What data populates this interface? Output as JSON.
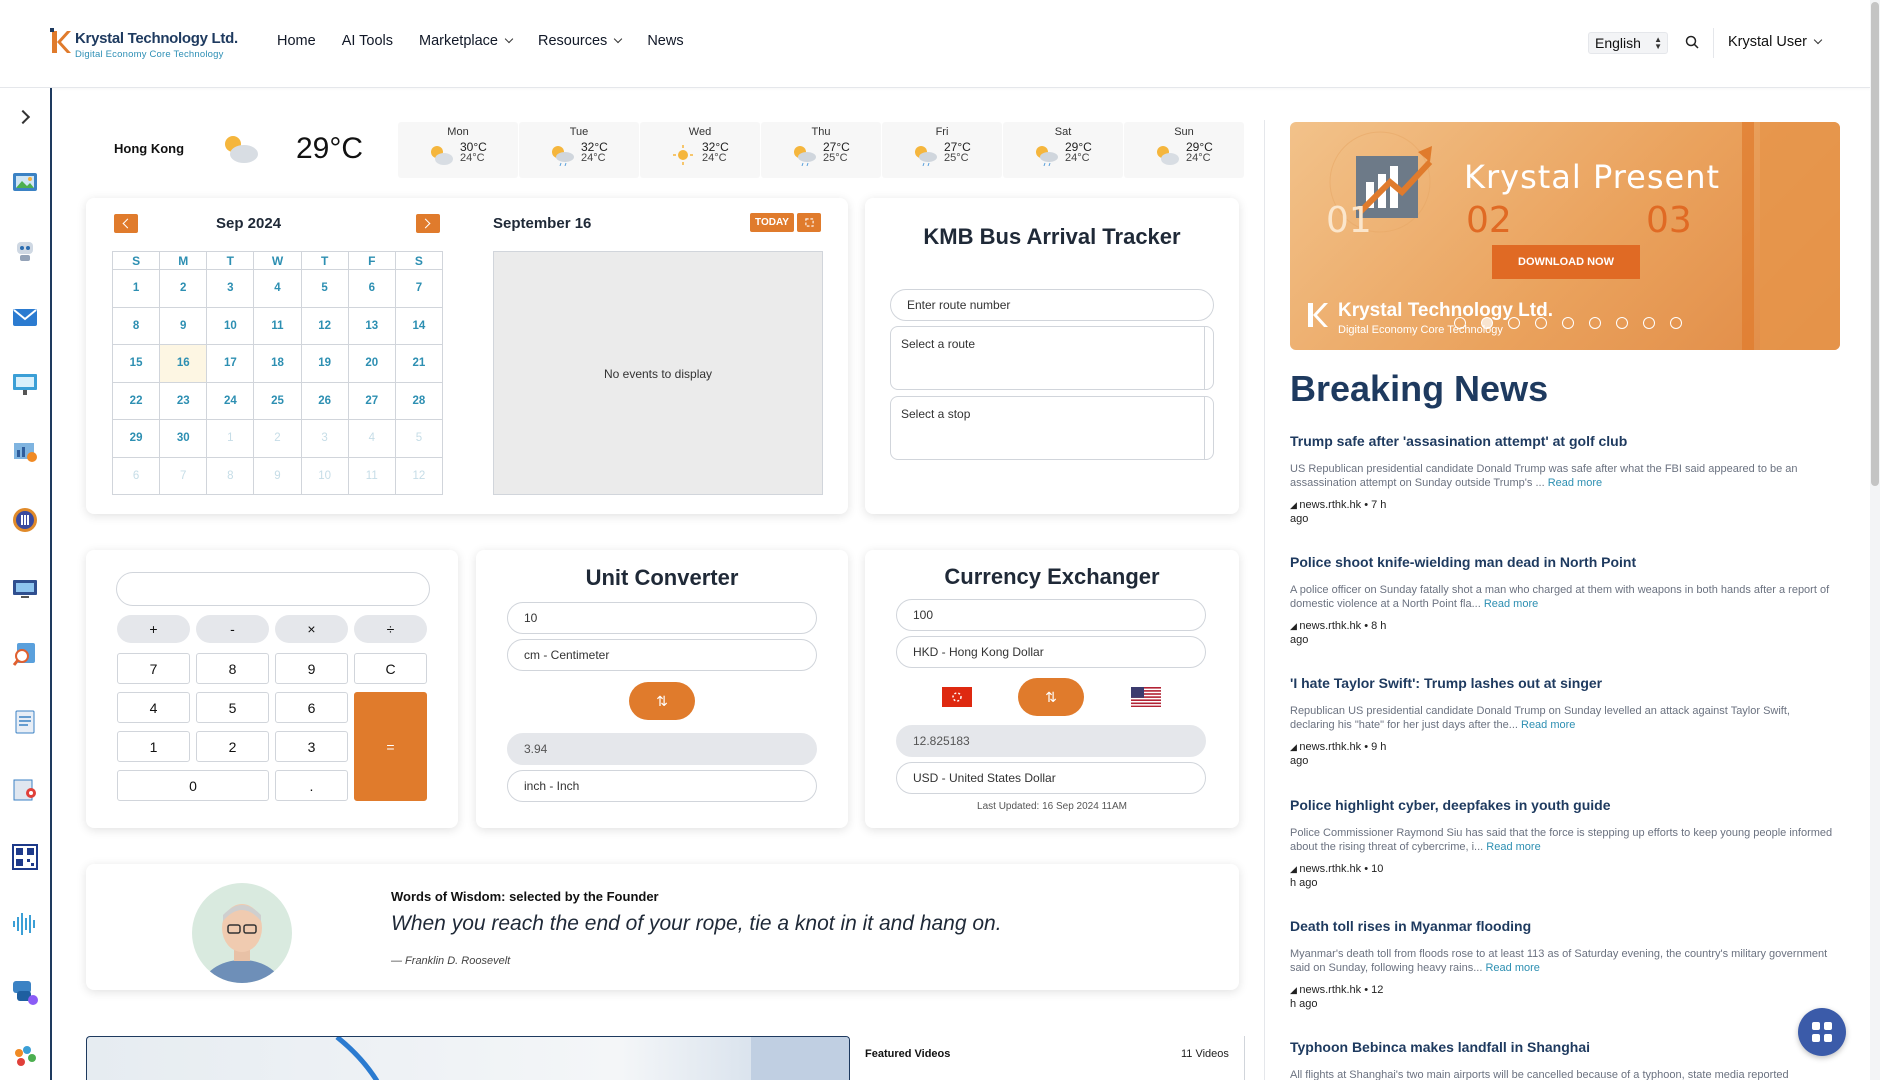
{
  "header": {
    "logo_name": "Krystal Technology Ltd.",
    "logo_tagline": "Digital Economy Core Technology",
    "nav": [
      "Home",
      "AI Tools",
      "Marketplace",
      "Resources",
      "News"
    ],
    "language": "English",
    "user": "Krystal User"
  },
  "weather": {
    "city": "Hong Kong",
    "current_temp": "29°C",
    "days": [
      {
        "day": "Mon",
        "hi": "30°C",
        "lo": "24°C",
        "icon": "partly-sunny-icon"
      },
      {
        "day": "Tue",
        "hi": "32°C",
        "lo": "24°C",
        "icon": "sun-rain-icon"
      },
      {
        "day": "Wed",
        "hi": "32°C",
        "lo": "24°C",
        "icon": "sun-icon"
      },
      {
        "day": "Thu",
        "hi": "27°C",
        "lo": "25°C",
        "icon": "sun-rain-icon"
      },
      {
        "day": "Fri",
        "hi": "27°C",
        "lo": "25°C",
        "icon": "sun-rain-icon"
      },
      {
        "day": "Sat",
        "hi": "29°C",
        "lo": "24°C",
        "icon": "sun-rain-icon"
      },
      {
        "day": "Sun",
        "hi": "29°C",
        "lo": "24°C",
        "icon": "partly-sunny-icon"
      }
    ]
  },
  "calendar": {
    "month": "Sep 2024",
    "weekdays": [
      "S",
      "M",
      "T",
      "W",
      "T",
      "F",
      "S"
    ],
    "weeks": [
      [
        "1",
        "2",
        "3",
        "4",
        "5",
        "6",
        "7"
      ],
      [
        "8",
        "9",
        "10",
        "11",
        "12",
        "13",
        "14"
      ],
      [
        "15",
        "16",
        "17",
        "18",
        "19",
        "20",
        "21"
      ],
      [
        "22",
        "23",
        "24",
        "25",
        "26",
        "27",
        "28"
      ],
      [
        "29",
        "30",
        "1",
        "2",
        "3",
        "4",
        "5"
      ],
      [
        "6",
        "7",
        "8",
        "9",
        "10",
        "11",
        "12"
      ]
    ],
    "selected_date": "September 16",
    "today_button": "TODAY",
    "empty_events": "No events to display"
  },
  "bus": {
    "title": "KMB Bus Arrival Tracker",
    "route_placeholder": "Enter route number",
    "route_select": "Select a route",
    "stop_select": "Select a stop"
  },
  "calculator": {
    "display": "",
    "ops": [
      "+",
      "-",
      "×",
      "÷"
    ],
    "rows": [
      [
        "7",
        "8",
        "9",
        "C"
      ],
      [
        "4",
        "5",
        "6"
      ],
      [
        "1",
        "2",
        "3"
      ],
      [
        "0",
        "."
      ]
    ],
    "equals": "="
  },
  "unit_converter": {
    "title": "Unit Converter",
    "input_value": "10",
    "from_unit": "cm - Centimeter",
    "swap": "⇅",
    "result": "3.94",
    "to_unit": "inch - Inch"
  },
  "currency": {
    "title": "Currency Exchanger",
    "amount": "100",
    "from": "HKD - Hong Kong Dollar",
    "swap": "⇅",
    "result": "12.825183",
    "to": "USD - United States Dollar",
    "updated": "Last Updated: 16 Sep 2024 11AM"
  },
  "wisdom": {
    "heading": "Words of Wisdom: selected by the Founder",
    "quote": "When you reach the end of your rope, tie a knot in it and hang on.",
    "author": "— Franklin D. Roosevelt"
  },
  "videos": {
    "label": "Featured Videos",
    "count": "11 Videos"
  },
  "banner": {
    "title": "Krystal Present",
    "numbers": [
      "01",
      "02",
      "03"
    ],
    "button": "DOWNLOAD NOW",
    "logo_name": "Krystal Technology Ltd.",
    "logo_tagline": "Digital Economy Core Technology",
    "dots": 9,
    "active_dot": 2
  },
  "news": {
    "heading": "Breaking News",
    "items": [
      {
        "title": "Trump safe after 'assasination attempt' at golf club",
        "desc": "US Republican presidential candidate Donald Trump was safe after what the FBI said appeared to be an assassination attempt on Sunday outside Trump's ...",
        "read": "Read more",
        "source": "news.rthk.hk • 7 h ago"
      },
      {
        "title": "Police shoot knife-wielding man dead in North Point",
        "desc": "A police officer on Sunday fatally shot a man who charged at them with weapons in both hands after a report of domestic violence at a North Point fla...",
        "read": "Read more",
        "source": "news.rthk.hk • 8 h ago"
      },
      {
        "title": "'I hate Taylor Swift': Trump lashes out at singer",
        "desc": "Republican US presidential candidate Donald Trump on Sunday levelled an attack against Taylor Swift, declaring his \"hate\" for her just days after the...",
        "read": "Read more",
        "source": "news.rthk.hk • 9 h ago"
      },
      {
        "title": "Police highlight cyber, deepfakes in youth guide",
        "desc": "Police Commissioner Raymond Siu has said that the force is stepping up efforts to keep young people informed about the rising threat of cybercrime, i...",
        "read": "Read more",
        "source": "news.rthk.hk • 10 h ago"
      },
      {
        "title": "Death toll rises in Myanmar flooding",
        "desc": "Myanmar's death toll from floods rose to at least 113 as of Saturday evening, the country's military government said on Sunday, following heavy rains...",
        "read": "Read more",
        "source": "news.rthk.hk • 12 h ago"
      },
      {
        "title": "Typhoon Bebinca makes landfall in Shanghai",
        "desc": "All flights at Shanghai's two main airports will be cancelled because of a typhoon, state media reported",
        "read": "",
        "source": ""
      }
    ]
  },
  "colors": {
    "accent": "#e07b2c",
    "brand": "#1e3a5f",
    "link": "#2d8fb2"
  }
}
